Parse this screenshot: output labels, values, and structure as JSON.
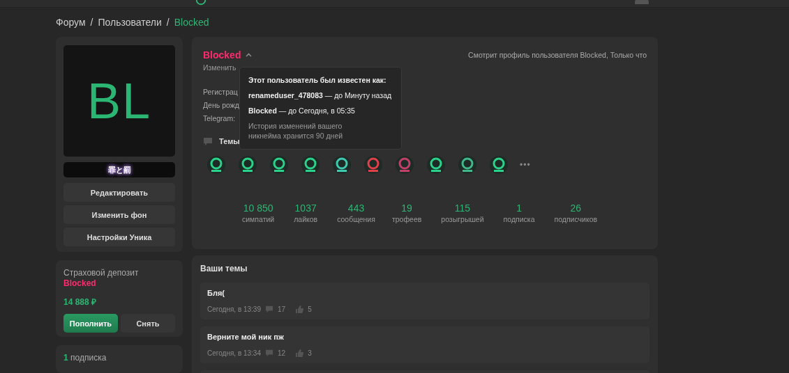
{
  "breadcrumb_separator": "/",
  "breadcrumbs": [
    {
      "label": "Форум",
      "current": false
    },
    {
      "label": "Пользователи",
      "current": false
    },
    {
      "label": "Blocked",
      "current": true
    }
  ],
  "profile_sidebar": {
    "avatar_initials": "BL",
    "banner": "罪と罰",
    "buttons": [
      "Редактировать",
      "Изменить фон",
      "Настройки Уника"
    ]
  },
  "deposit": {
    "title": "Страховой депозит",
    "username": "Blocked",
    "amount": "14 888 ₽",
    "buttons": [
      {
        "label": "Пополнить",
        "primary": true
      },
      {
        "label": "Снять",
        "primary": false
      }
    ]
  },
  "subscriptions": {
    "count": "1",
    "label": "подписка"
  },
  "profile": {
    "username": "Blocked",
    "expanded": true,
    "viewing": "Смотрит профиль пользователя Blocked, Только что",
    "change_link": "Изменить",
    "info_labels": [
      "Регистрац",
      "День рожд",
      "Telegram:"
    ],
    "topics_link": "Темы",
    "tooltip": {
      "title": "Этот пользователь был известен как:",
      "history": [
        "**renameduser_478083** — до Минуту назад",
        "**Blocked** — до Сегодня, в 05:35"
      ],
      "note": "История изменений вашего никнейма хранится 90 дней"
    },
    "trophies": [
      {
        "color": "#2bd38a"
      },
      {
        "color": "#2bd38a"
      },
      {
        "color": "#2bd38a"
      },
      {
        "color": "#2bd38a"
      },
      {
        "color": "#3fc9b0"
      },
      {
        "color": "#e0404a"
      },
      {
        "color": "#c0406a"
      },
      {
        "color": "#2bd38a"
      },
      {
        "color": "#3fb98a"
      },
      {
        "color": "#2bd38a"
      }
    ],
    "more": "•••",
    "stats": [
      {
        "value": "10 850",
        "label": "симпатий"
      },
      {
        "value": "1037",
        "label": "лайков"
      },
      {
        "value": "443",
        "label": "сообщения"
      },
      {
        "value": "19",
        "label": "трофеев"
      },
      {
        "value": "115",
        "label": "розыгрышей"
      },
      {
        "value": "1",
        "label": "подписка"
      },
      {
        "value": "26",
        "label": "подписчиков"
      }
    ]
  },
  "topics": {
    "title": "Ваши темы",
    "items": [
      {
        "title": "Бля(",
        "date": "Сегодня, в 13:39",
        "comments": "17",
        "likes": "5"
      },
      {
        "title": "Верните мой ник пж",
        "date": "Сегодня, в 13:34",
        "comments": "12",
        "likes": "3"
      }
    ]
  }
}
